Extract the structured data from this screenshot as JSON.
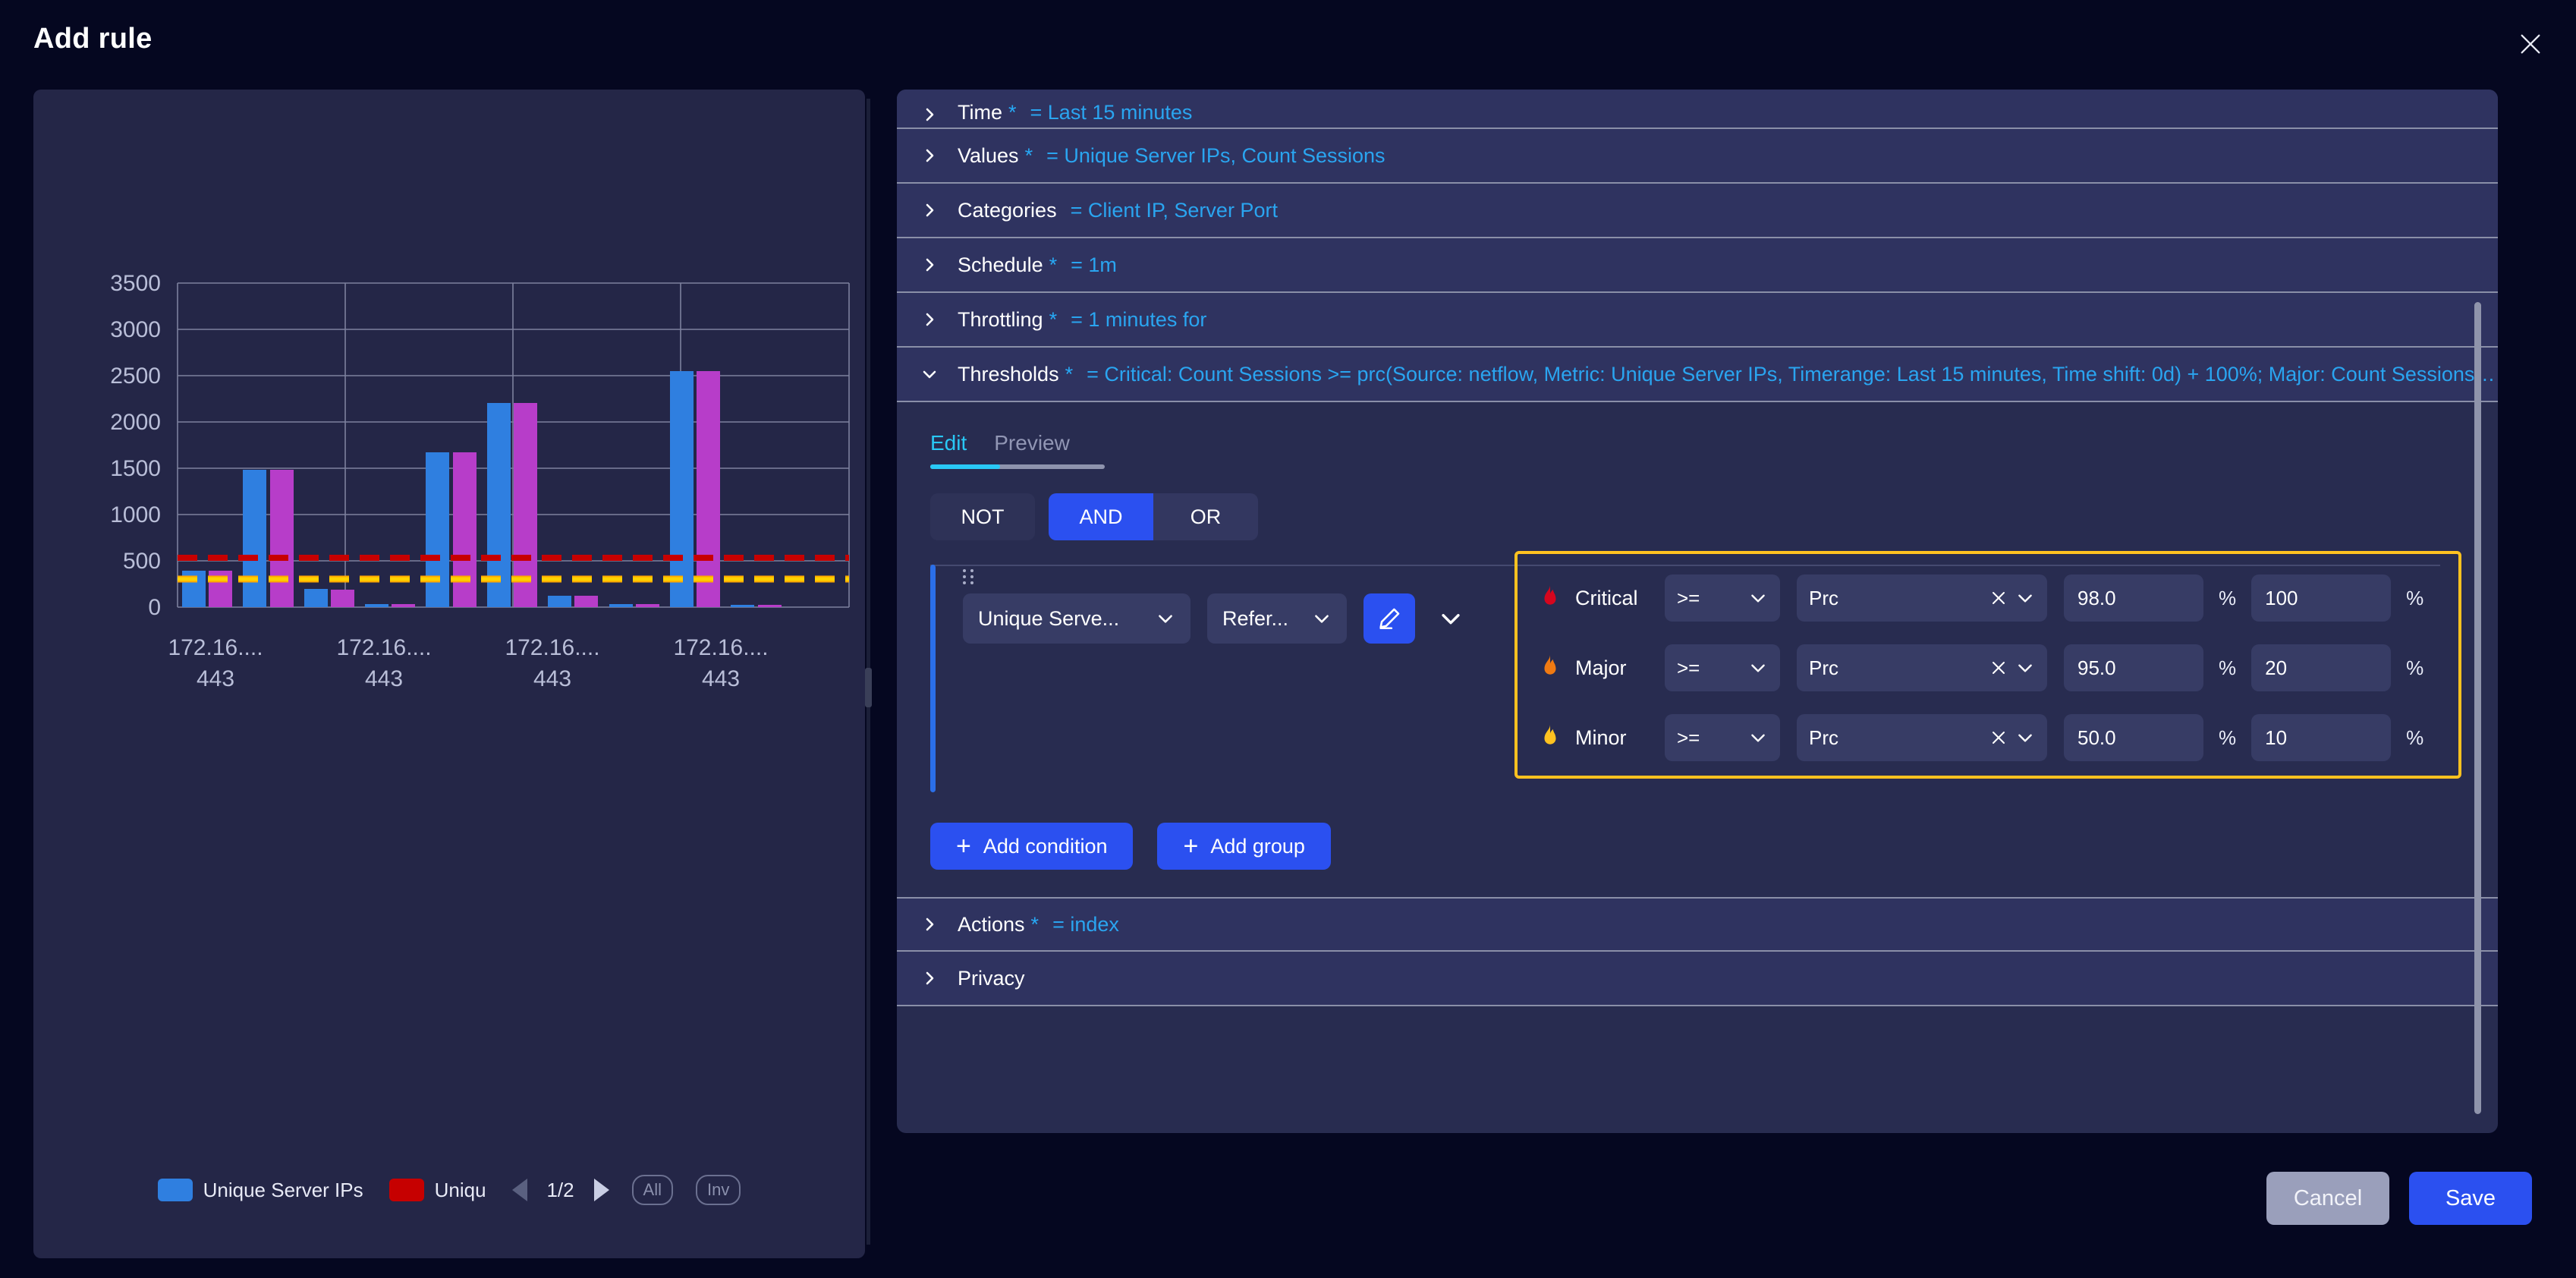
{
  "header": {
    "title": "Add rule",
    "close_icon": "close-icon"
  },
  "chart_data": {
    "type": "bar",
    "title": "",
    "xlabel": "",
    "ylabel": "",
    "ylim": [
      0,
      3500
    ],
    "yticks": [
      0,
      500,
      1000,
      1500,
      2000,
      2500,
      3000,
      3500
    ],
    "grid": true,
    "categories": [
      "172.16.... 443",
      "172.16.... 443",
      "172.16.... 443",
      "172.16.... 443"
    ],
    "group_labels_line1": [
      "172.16....",
      "172.16....",
      "172.16....",
      "172.16...."
    ],
    "group_labels_line2": [
      "443",
      "443",
      "443",
      "443"
    ],
    "series": [
      {
        "name": "Unique Server IPs",
        "color": "#2f7fe0",
        "values": [
          390,
          1480,
          200,
          30,
          1670,
          2200,
          120,
          30,
          2545,
          20
        ]
      },
      {
        "name": "Uniqu",
        "color": "#b73dc9",
        "values": [
          390,
          1480,
          195,
          30,
          1670,
          2200,
          120,
          30,
          2545,
          18
        ]
      }
    ],
    "threshold_lines": [
      {
        "name": "critical",
        "value": 535,
        "color": "#c70000",
        "style": "dashed"
      },
      {
        "name": "major",
        "value": 320,
        "color": "#ffa800",
        "style": "dashed"
      },
      {
        "name": "minor",
        "value": 305,
        "color": "#ffd200",
        "style": "dashed"
      }
    ],
    "legend": {
      "position": "bottom",
      "entries": [
        {
          "label": "Unique Server IPs",
          "color": "#2f7fe0"
        },
        {
          "label": "Uniqu",
          "color": "#c60000"
        }
      ],
      "page": "1/2",
      "all_label": "All",
      "inv_label": "Inv"
    }
  },
  "accordion": [
    {
      "label": "Time",
      "required": true,
      "value": "= Last 15 minutes",
      "expanded": false
    },
    {
      "label": "Values",
      "required": true,
      "value": "= Unique Server IPs, Count Sessions",
      "expanded": false
    },
    {
      "label": "Categories",
      "required": false,
      "value": "= Client IP, Server Port",
      "expanded": false
    },
    {
      "label": "Schedule",
      "required": true,
      "value": "= 1m",
      "expanded": false
    },
    {
      "label": "Throttling",
      "required": true,
      "value": "= 1 minutes for",
      "expanded": false
    },
    {
      "label": "Thresholds",
      "required": true,
      "value": "= Critical: Count Sessions >= prc(Source: netflow, Metric: Unique Server IPs, Timerange: Last 15 minutes, Time shift: 0d) + 100%; Major: Count Sessions >=…",
      "expanded": true
    }
  ],
  "accordion_bottom": [
    {
      "label": "Actions",
      "required": true,
      "value": "= index",
      "expanded": false
    },
    {
      "label": "Privacy",
      "required": false,
      "value": "",
      "expanded": false
    }
  ],
  "editor": {
    "tabs": [
      {
        "label": "Edit",
        "active": true
      },
      {
        "label": "Preview",
        "active": false
      }
    ],
    "logic_buttons": [
      {
        "label": "NOT",
        "state": "off"
      },
      {
        "label": "AND",
        "state": "on"
      },
      {
        "label": "OR",
        "state": "off"
      }
    ],
    "condition": {
      "metric_select": "Unique Serve...",
      "reference_select": "Refer...",
      "edit_icon": "pencil-icon",
      "expand_icon": "chevron-down-icon"
    },
    "thresholds": [
      {
        "severity": "Critical",
        "flame_color": "#d6061e",
        "operator": ">=",
        "function": "Prc",
        "value": "98.0",
        "value_unit": "%",
        "offset": "100",
        "offset_unit": "%"
      },
      {
        "severity": "Major",
        "flame_color": "#f07a12",
        "operator": ">=",
        "function": "Prc",
        "value": "95.0",
        "value_unit": "%",
        "offset": "20",
        "offset_unit": "%"
      },
      {
        "severity": "Minor",
        "flame_color": "#ffc220",
        "operator": ">=",
        "function": "Prc",
        "value": "50.0",
        "value_unit": "%",
        "offset": "10",
        "offset_unit": "%"
      }
    ],
    "add_condition_label": "Add condition",
    "add_group_label": "Add group",
    "plus": "+"
  },
  "footer": {
    "cancel_label": "Cancel",
    "save_label": "Save"
  }
}
